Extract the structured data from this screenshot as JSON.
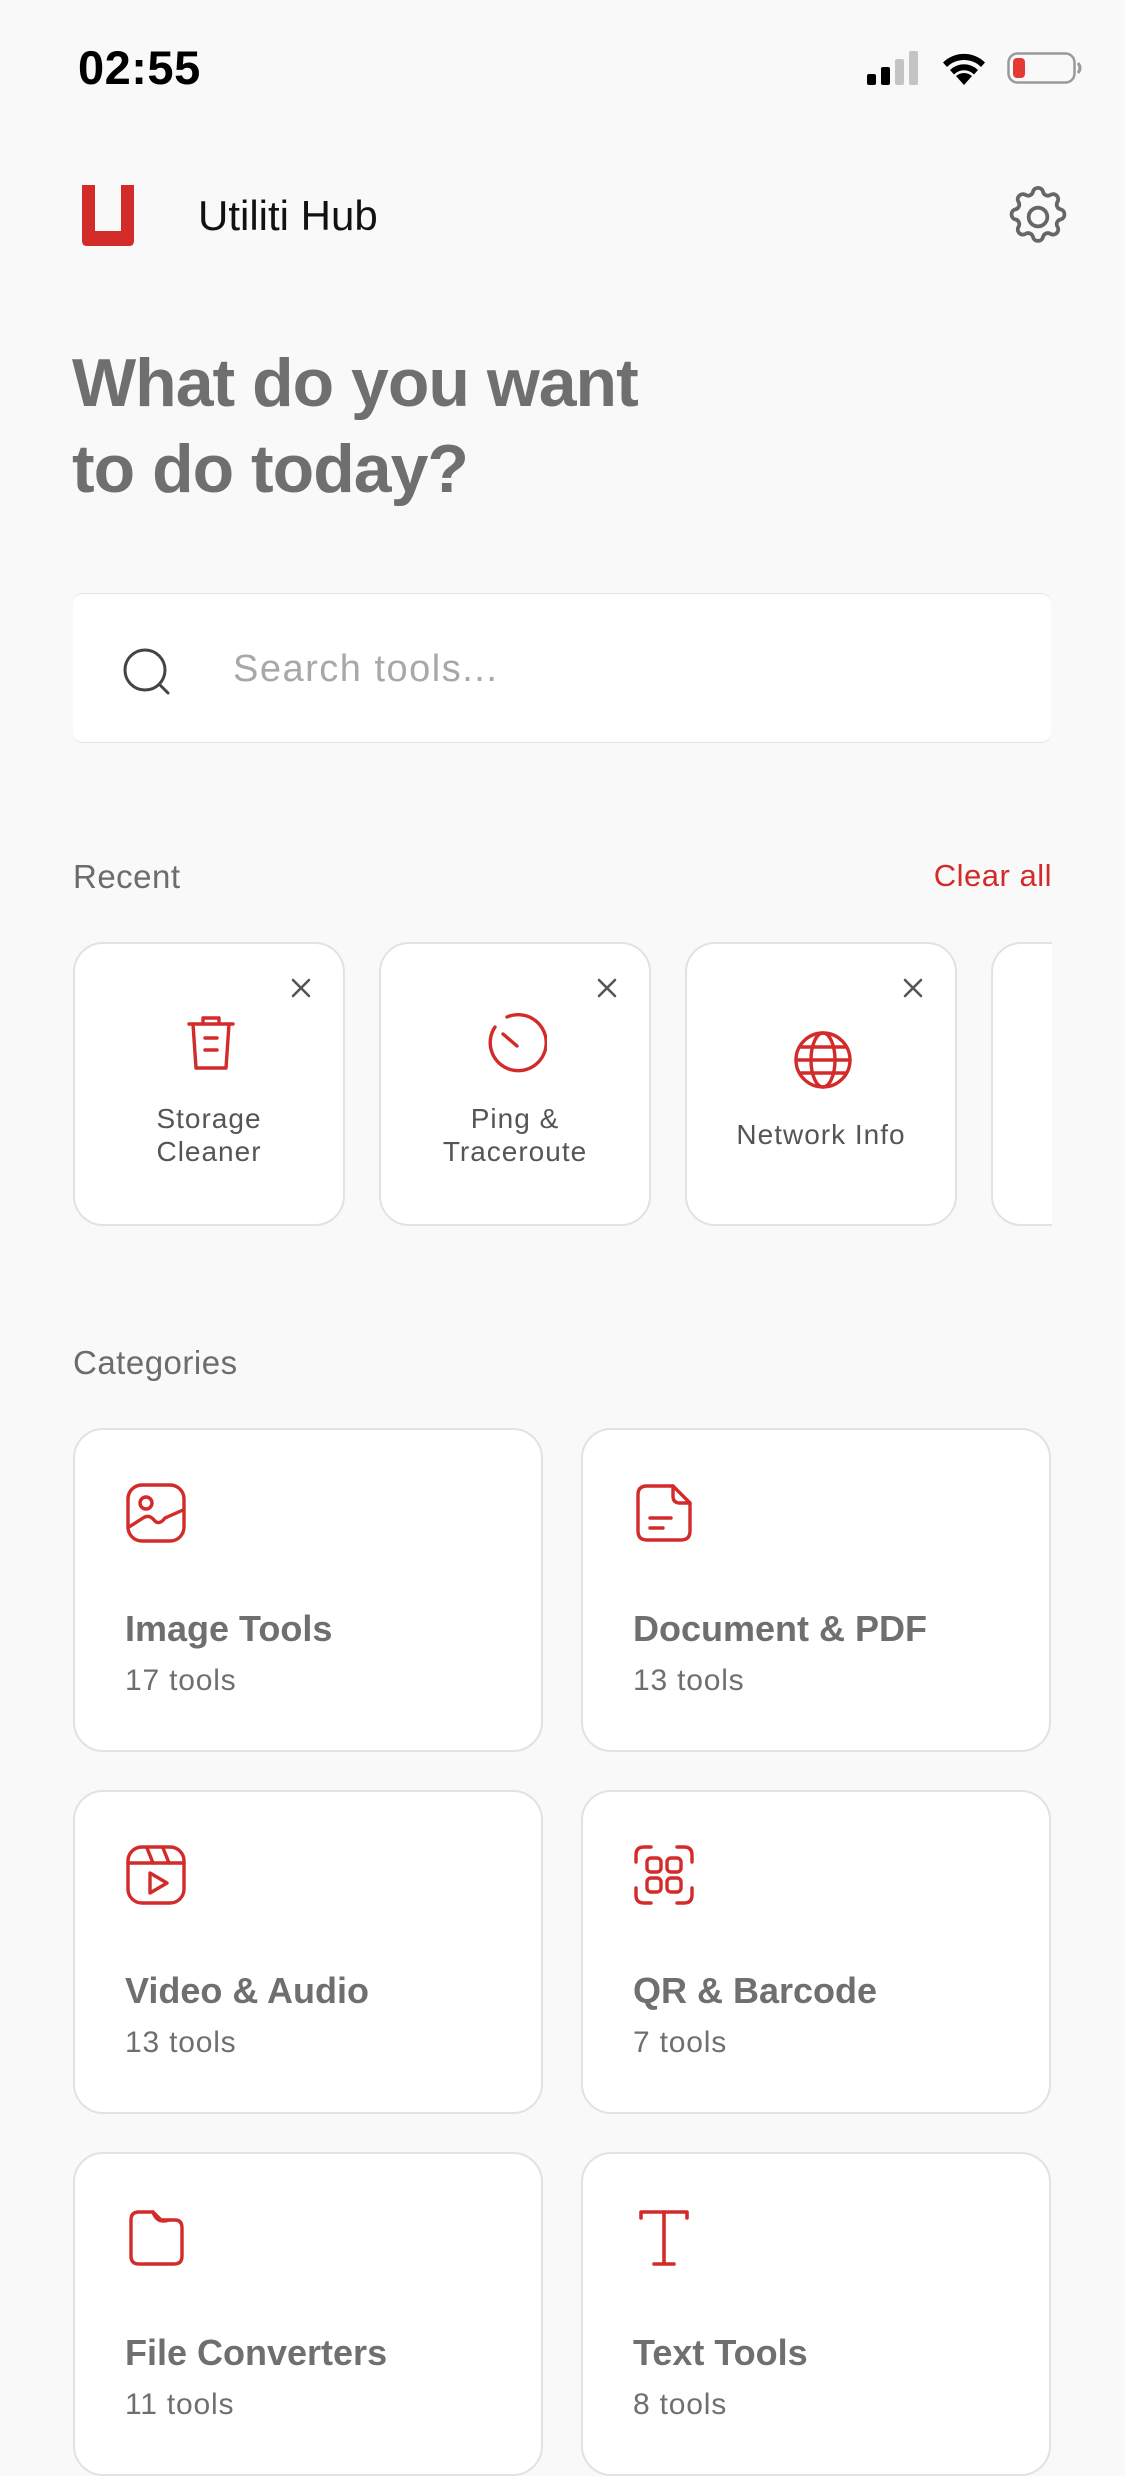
{
  "status_bar": {
    "time": "02:55"
  },
  "app": {
    "title": "Utiliti Hub"
  },
  "hero": {
    "line1": "What do you want",
    "line2": "to do today?"
  },
  "search": {
    "placeholder": "Search tools..."
  },
  "recent": {
    "label": "Recent",
    "clear_label": "Clear all",
    "items": [
      {
        "line1": "Storage",
        "line2": "Cleaner",
        "icon": "trash-icon"
      },
      {
        "line1": "Ping &",
        "line2": "Traceroute",
        "icon": "speedometer-icon"
      },
      {
        "line1": "Network Info",
        "line2": "",
        "icon": "globe-icon"
      }
    ]
  },
  "categories": {
    "label": "Categories",
    "items": [
      {
        "name": "Image Tools",
        "count": "17 tools",
        "icon": "image-icon"
      },
      {
        "name": "Document & PDF",
        "count": "13 tools",
        "icon": "document-icon"
      },
      {
        "name": "Video & Audio",
        "count": "13 tools",
        "icon": "video-icon"
      },
      {
        "name": "QR & Barcode",
        "count": "7 tools",
        "icon": "qr-scan-icon"
      },
      {
        "name": "File Converters",
        "count": "11 tools",
        "icon": "folder-icon"
      },
      {
        "name": "Text Tools",
        "count": "8 tools",
        "icon": "text-icon"
      }
    ]
  },
  "colors": {
    "accent": "#d32a2a",
    "background": "#f9f9f9",
    "card": "#ffffff",
    "border": "#e2e2e2",
    "muted_text": "#6f6f6f"
  }
}
